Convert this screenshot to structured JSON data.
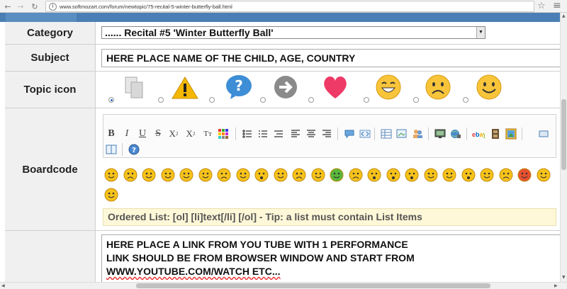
{
  "browser": {
    "url": "www.softmozart.com/forum/newtopic/75-recital-5-winter-butterfly-ball.html"
  },
  "form": {
    "category": {
      "label": "Category",
      "selected": "...... Recital #5 'Winter Butterfly Ball'"
    },
    "subject": {
      "label": "Subject",
      "value": "HERE PLACE NAME OF THE CHILD, AGE, COUNTRY"
    },
    "topic_icon": {
      "label": "Topic icon",
      "options": [
        "document-icon",
        "warning-icon",
        "question-icon",
        "arrow-icon",
        "heart-icon",
        "laugh-icon",
        "sad-icon",
        "smile-icon"
      ],
      "selected": "document-icon"
    },
    "boardcode": {
      "label": "Boardcode",
      "toolbar": {
        "bold": "B",
        "italic": "I",
        "underline": "U",
        "strike": "S",
        "subscript": "X",
        "superscript": "X",
        "sub_mark": "2",
        "sup_mark": "2",
        "font_size": "Tт"
      },
      "helpline": "Ordered List: [ol] [li]text[/li] [/ol] - Tip: a list must contain List Items"
    },
    "message": {
      "lines": [
        "HERE PLACE A LINK FROM YOU TUBE WITH 1 PERFORMANCE",
        "LINK SHOULD BE FROM BROWSER WINDOW AND START FROM",
        "WWW.YOUTUBE.COM/WATCH ETC..."
      ]
    }
  },
  "colors": {
    "header_blue": "#4a7fb5",
    "label_bg": "#f0f0f0",
    "helpline_bg": "#fff8d8",
    "smiley_yellow": "#f7c21a"
  }
}
